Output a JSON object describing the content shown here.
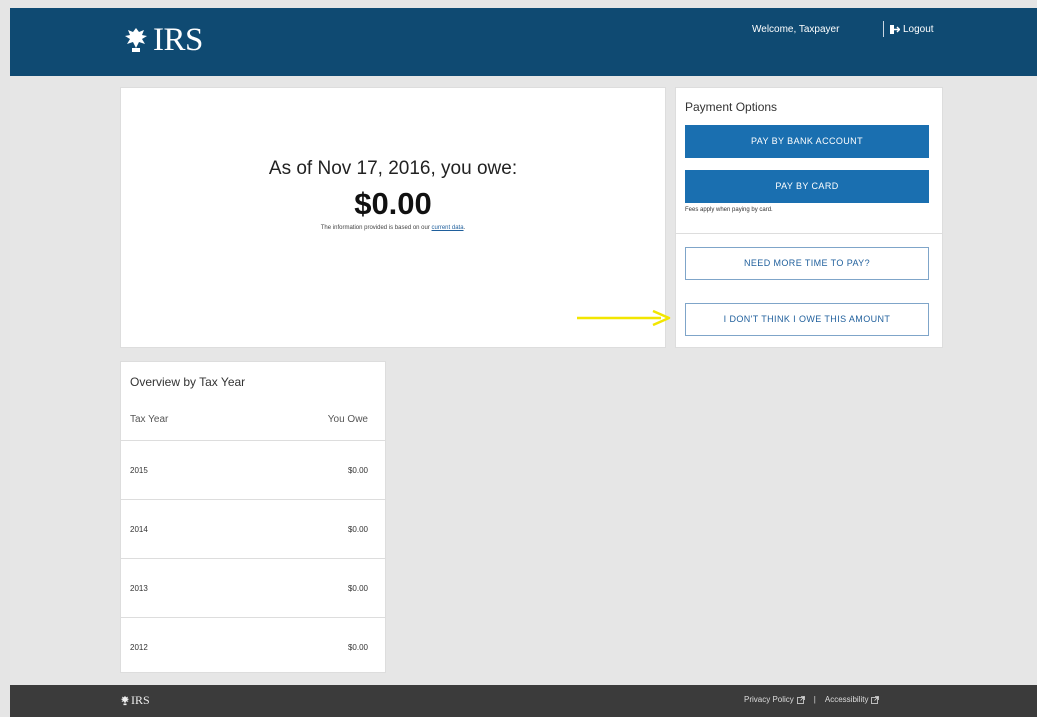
{
  "header": {
    "logo_text": "IRS",
    "welcome": "Welcome, Taxpayer",
    "logout": "Logout"
  },
  "balance": {
    "title": "As of Nov 17, 2016, you owe:",
    "amount": "$0.00",
    "note_prefix": "The information provided is based on our",
    "note_link": "current data",
    "note_suffix": "."
  },
  "payment": {
    "title": "Payment Options",
    "bank_button": "PAY BY BANK ACCOUNT",
    "card_button": "PAY BY CARD",
    "fees_note": "Fees apply when paying by card.",
    "more_time_button": "NEED MORE TIME TO PAY?",
    "dispute_button": "I DON'T THINK I OWE THIS AMOUNT"
  },
  "overview": {
    "title": "Overview by Tax Year",
    "col_year": "Tax Year",
    "col_owe": "You Owe",
    "rows": [
      {
        "year": "2015",
        "amount": "$0.00"
      },
      {
        "year": "2014",
        "amount": "$0.00"
      },
      {
        "year": "2013",
        "amount": "$0.00"
      },
      {
        "year": "2012",
        "amount": "$0.00"
      }
    ]
  },
  "footer": {
    "logo_text": "IRS",
    "privacy": "Privacy Policy",
    "separator": "|",
    "accessibility": "Accessibility"
  },
  "colors": {
    "header_bg": "#0f4a72",
    "primary_button": "#1a6fb0",
    "footer_bg": "#3b3b3b",
    "arrow": "#f2e600"
  },
  "icons": [
    "eagle-logo-icon",
    "logout-icon",
    "external-link-icon",
    "arrow-annotation-icon"
  ]
}
